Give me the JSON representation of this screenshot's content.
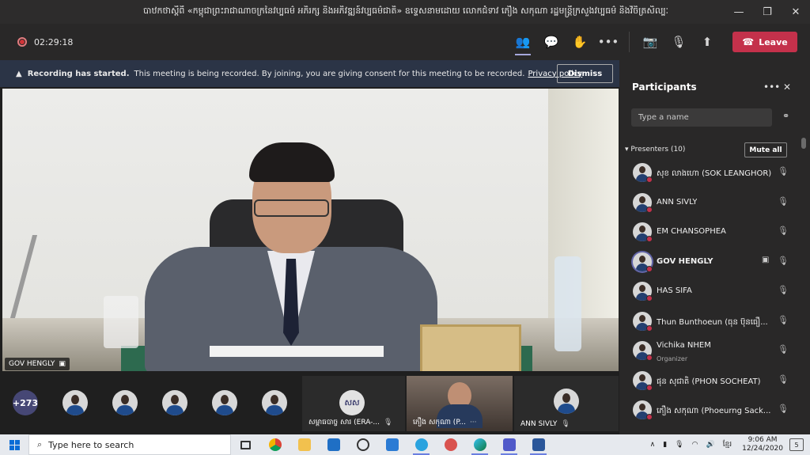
{
  "window": {
    "title": "បាឋកថាស្តីពី «កម្ពុជាព្រះរាជាណាចក្រនៃវប្បធម៌ អភិរក្ស និងអភិវឌ្ឍន៍វប្បធម៌ជាតិ» ឧទ្ទេសនាមដោយ លោកជំទាវ ភឿង សកុណា រដ្ឋមន្ត្រីក្រសួងវប្បធម៌ និងវិចិត្រសិល្បៈ",
    "minimize": "—",
    "maximize": "❐",
    "close": "✕"
  },
  "toolbar": {
    "timer": "02:29:18",
    "leave_label": "Leave",
    "icons": {
      "participants": "👥",
      "chat": "💬",
      "raise_hand": "✋",
      "more": "•••",
      "camera_off": "📷",
      "mic_off": "🎙",
      "share": "⬆"
    }
  },
  "banner": {
    "bold": "Recording has started.",
    "text": "This meeting is being recorded. By joining, you are giving consent for this meeting to be recorded.",
    "link": "Privacy policy",
    "dismiss": "Dismiss"
  },
  "stage": {
    "speaker_name": "GOV HENGLY"
  },
  "tiles": {
    "overflow_count": "+273",
    "initials": "សស",
    "tile1_label": "សម្ពាធបាច្ច សារ (ERA-...",
    "tile2_label": "ភឿង សកុណា (P...",
    "tile3_label": "ANN SIVLY"
  },
  "panel": {
    "title": "Participants",
    "more": "•••",
    "close": "✕",
    "search_placeholder": "Type a name",
    "section": "Presenters (10)",
    "mute_all": "Mute all",
    "participants": [
      {
        "name": "សុខ លាងហោ (SOK LEANGHOR)",
        "role": ""
      },
      {
        "name": "ANN SIVLY",
        "role": ""
      },
      {
        "name": "EM CHANSOPHEA",
        "role": ""
      },
      {
        "name": "GOV HENGLY",
        "role": ""
      },
      {
        "name": "HAS SIFA",
        "role": ""
      },
      {
        "name": "Thun Bunthoeun (ធុន ប៊ុនធឿ...",
        "role": ""
      },
      {
        "name": "Vichika NHEM",
        "role": "Organizer"
      },
      {
        "name": "ផុន សុជាតិ (PHON SOCHEAT)",
        "role": ""
      },
      {
        "name": "ភឿង សកុណា (Phoeurng Sack...",
        "role": ""
      }
    ]
  },
  "taskbar": {
    "search_placeholder": "Type here to search",
    "time": "9:06 AM",
    "date": "12/24/2020",
    "lang": "ខ្មែរ",
    "notifications": "5"
  }
}
